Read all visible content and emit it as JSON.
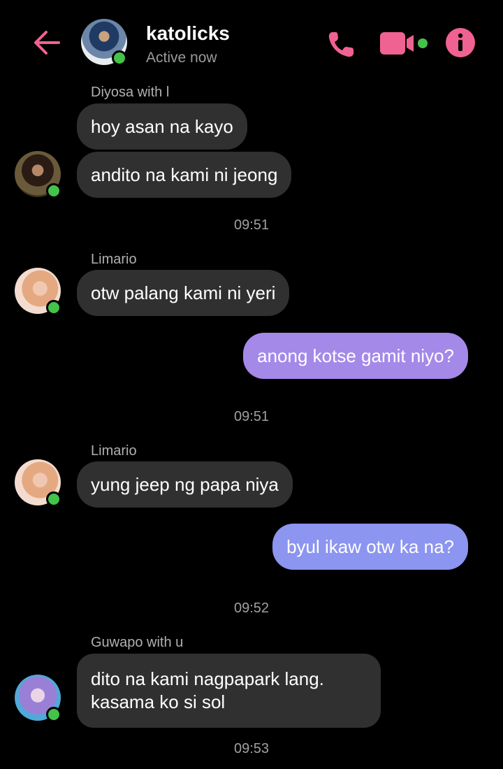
{
  "header": {
    "name": "katolicks",
    "status": "Active now"
  },
  "messages": [
    {
      "sender": "Diyosa with l"
    },
    {
      "text": "hoy asan na kayo"
    },
    {
      "text": "andito na kami ni jeong"
    },
    {
      "time": "09:51"
    },
    {
      "sender": "Limario"
    },
    {
      "text": "otw palang kami ni yeri"
    },
    {
      "text": "anong kotse gamit niyo?"
    },
    {
      "time": "09:51"
    },
    {
      "sender": "Limario"
    },
    {
      "text": "yung jeep ng papa niya"
    },
    {
      "text": "byul ikaw otw ka na?"
    },
    {
      "time": "09:52"
    },
    {
      "sender": "Guwapo with u"
    },
    {
      "text": "dito na kami nagpapark lang.\nkasama ko si sol"
    },
    {
      "time": "09:53"
    }
  ],
  "colors": {
    "accent": "#f06292",
    "online": "#44c24a",
    "incoming_bubble": "#303030",
    "outgoing_bubble_1": "#a489e8",
    "outgoing_bubble_2": "#8c95f0"
  }
}
